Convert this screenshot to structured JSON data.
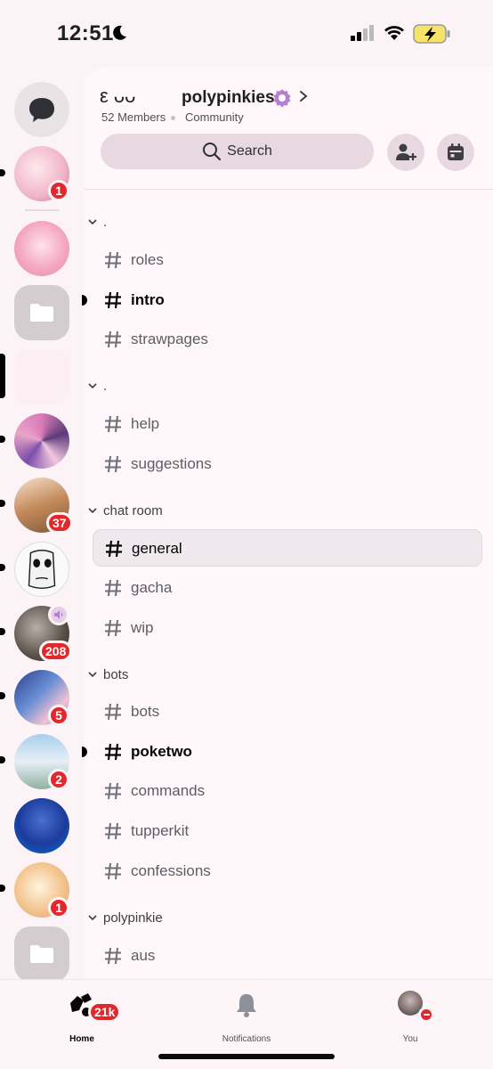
{
  "status_bar": {
    "time": "12:51"
  },
  "server": {
    "emoji": "ε  ᴗᴗ",
    "name": "polypinkies",
    "members": "52 Members",
    "type": "Community"
  },
  "search": {
    "label": "Search"
  },
  "rail": {
    "badges": [
      "1",
      "37",
      "208",
      "5",
      "2",
      "1"
    ]
  },
  "categories": [
    {
      "label": "."
    },
    {
      "label": "."
    },
    {
      "label": "chat room"
    },
    {
      "label": "bots"
    },
    {
      "label": "polypinkie"
    }
  ],
  "channels": [
    {
      "label": "roles"
    },
    {
      "label": "intro"
    },
    {
      "label": "strawpages"
    },
    {
      "label": "help"
    },
    {
      "label": "suggestions"
    },
    {
      "label": "general"
    },
    {
      "label": "gacha"
    },
    {
      "label": "wip"
    },
    {
      "label": "bots"
    },
    {
      "label": "poketwo"
    },
    {
      "label": "commands"
    },
    {
      "label": "tupperkit"
    },
    {
      "label": "confessions"
    },
    {
      "label": "aus"
    }
  ],
  "nav": {
    "home": "Home",
    "home_badge": "21k",
    "notifications": "Notifications",
    "you": "You"
  },
  "colors": {
    "accent_bg": "#e8d8e0",
    "badge_red": "#e0282d",
    "verify_purple": "#b57fd2"
  }
}
